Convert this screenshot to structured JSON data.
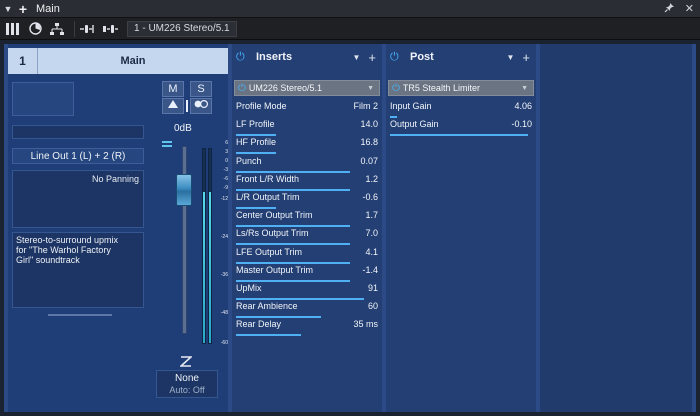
{
  "window": {
    "title": "Main"
  },
  "toolbar": {
    "io_label": "1 - UM226 Stereo/5.1"
  },
  "channel": {
    "number": "1",
    "name": "Main",
    "mute_label": "M",
    "solo_label": "S",
    "db_readout": "0dB",
    "output": "Line Out 1 (L) + 2 (R)",
    "panning": "No Panning",
    "notes": "Stereo-to-surround upmix for \"The Warhol Factory Girl\" soundtrack",
    "automation_mode": "None",
    "automation_state": "Auto: Off",
    "meter_level": 0.78,
    "fader_level": 0.82,
    "scale": [
      "6",
      "3",
      "0",
      "-3",
      "-6",
      "-9",
      "-12",
      "-24",
      "-36",
      "-48",
      "-60"
    ]
  },
  "inserts": {
    "label": "Inserts",
    "plugin": "UM226 Stereo/5.1",
    "params": [
      {
        "label": "Profile Mode",
        "value": "Film 2",
        "level": 0.0
      },
      {
        "label": "LF Profile",
        "value": "14.0",
        "level": 0.28
      },
      {
        "label": "HF Profile",
        "value": "16.8",
        "level": 0.28
      },
      {
        "label": "Punch",
        "value": "0.07",
        "level": 0.8
      },
      {
        "label": "Front L/R Width",
        "value": "1.2",
        "level": 0.8
      },
      {
        "label": "L/R Output Trim",
        "value": "-0.6",
        "level": 0.28
      },
      {
        "label": "Center Output Trim",
        "value": "1.7",
        "level": 0.8
      },
      {
        "label": "Ls/Rs Output Trim",
        "value": "7.0",
        "level": 0.8
      },
      {
        "label": "LFE Output Trim",
        "value": "4.1",
        "level": 0.8
      },
      {
        "label": "Master Output Trim",
        "value": "-1.4",
        "level": 0.8
      },
      {
        "label": "UpMix",
        "value": "91",
        "level": 0.9
      },
      {
        "label": "Rear Ambience",
        "value": "60",
        "level": 0.6
      },
      {
        "label": "Rear Delay",
        "value": "35 ms",
        "level": 0.46
      }
    ]
  },
  "post": {
    "label": "Post",
    "plugin": "TR5 Stealth Limiter",
    "params": [
      {
        "label": "Input Gain",
        "value": "4.06",
        "level": 0.05
      },
      {
        "label": "Output Gain",
        "value": "-0.10",
        "level": 0.97
      }
    ]
  },
  "colors": {
    "accent": "#4fb0f4",
    "panel": "#233f74",
    "strip": "#1f3e78"
  }
}
